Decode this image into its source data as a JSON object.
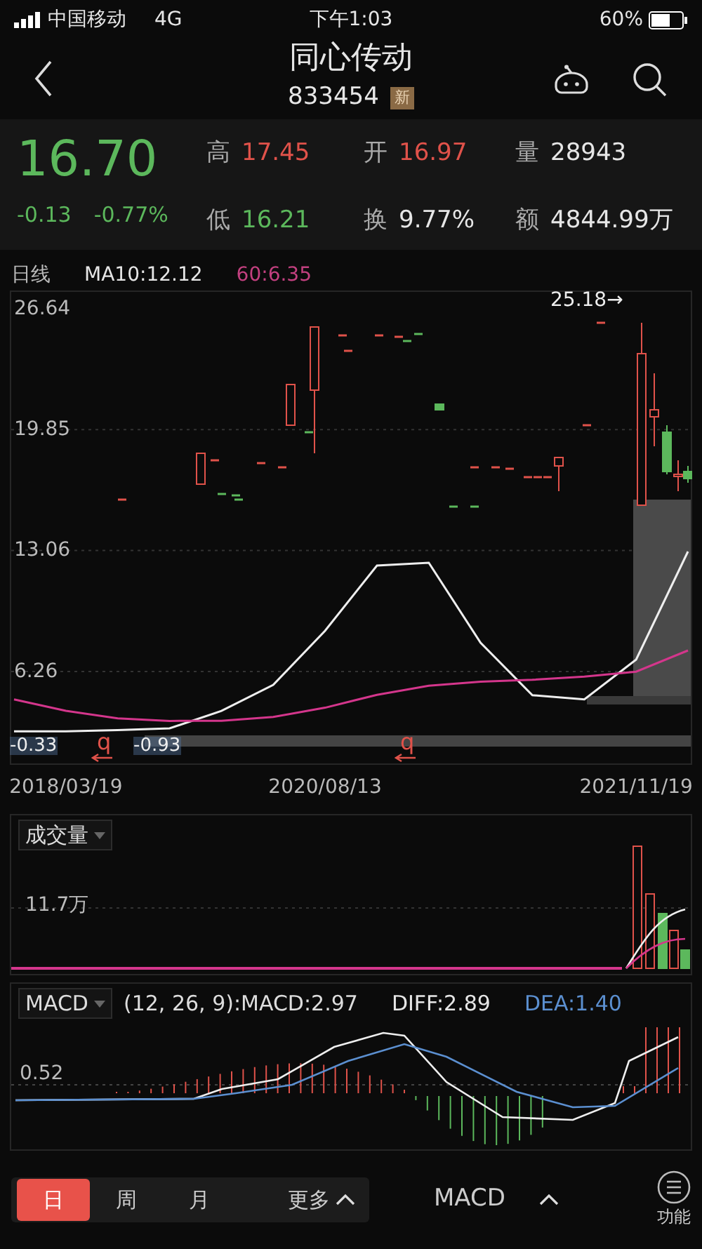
{
  "status_bar": {
    "carrier": "中国移动",
    "network": "4G",
    "time": "下午1:03",
    "battery": "60%"
  },
  "header": {
    "title": "同心传动",
    "code": "833454",
    "badge": "新"
  },
  "quote": {
    "price": "16.70",
    "change": "-0.13",
    "change_pct": "-0.77%",
    "color": "#5cb85c",
    "stats": [
      {
        "label": "高",
        "value": "17.45",
        "color": "#e0524a"
      },
      {
        "label": "开",
        "value": "16.97",
        "color": "#e0524a"
      },
      {
        "label": "量",
        "value": "28943",
        "color": "#e6e6e6"
      },
      {
        "label": "低",
        "value": "16.21",
        "color": "#5cb85c"
      },
      {
        "label": "换",
        "value": "9.77%",
        "color": "#e6e6e6"
      },
      {
        "label": "额",
        "value": "4844.99万",
        "color": "#e6e6e6"
      }
    ]
  },
  "price_chart": {
    "period_label": "日线",
    "ma_labels": [
      {
        "text": "MA10:12.12",
        "color": "#e6e6e6"
      },
      {
        "text": "60:6.35",
        "color": "#c2407f"
      }
    ],
    "high_marker": "25.18→",
    "low_labels": [
      "-0.33",
      "-0.93"
    ],
    "event_marks": [
      "q",
      "q"
    ],
    "chart_data": {
      "type": "line",
      "categories": [
        null,
        "2018/03/19",
        null,
        null,
        null,
        null,
        "2020/08/13",
        null,
        null,
        null,
        null,
        null,
        "2021/11/19",
        null
      ],
      "series": [
        {
          "color": "#eeeeee",
          "values": [
            2.9,
            2.9,
            2.96,
            3.06,
            4.04,
            5.51,
            8.54,
            12.21,
            12.37,
            7.87,
            4.92,
            4.69,
            6.93,
            13.0
          ]
        },
        {
          "color": "#d4368c",
          "values": [
            4.69,
            4.05,
            3.62,
            3.48,
            3.49,
            3.7,
            4.22,
            4.95,
            5.46,
            5.68,
            5.79,
            5.97,
            6.25,
            7.44
          ]
        }
      ],
      "grid": true,
      "ylim": [
        1.09,
        27.59
      ],
      "yticks": [
        26.64,
        19.85,
        13.06,
        6.26
      ]
    }
  },
  "volume": {
    "indicator": "成交量",
    "y_label": "11.7万"
  },
  "macd": {
    "indicator": "MACD",
    "params": "(12, 26, 9):MACD:2.97",
    "values": [
      {
        "text": "DIFF:2.89",
        "color": "#e6e6e6"
      },
      {
        "text": "DEA:1.40",
        "color": "#5b8fd0"
      }
    ],
    "y_label": "0.52"
  },
  "bottom_bar": {
    "periods": [
      {
        "label": "日",
        "selected": true
      },
      {
        "label": "周",
        "selected": false
      },
      {
        "label": "月",
        "selected": false
      }
    ],
    "more": "更多",
    "indicator": "MACD",
    "function": "功能"
  }
}
